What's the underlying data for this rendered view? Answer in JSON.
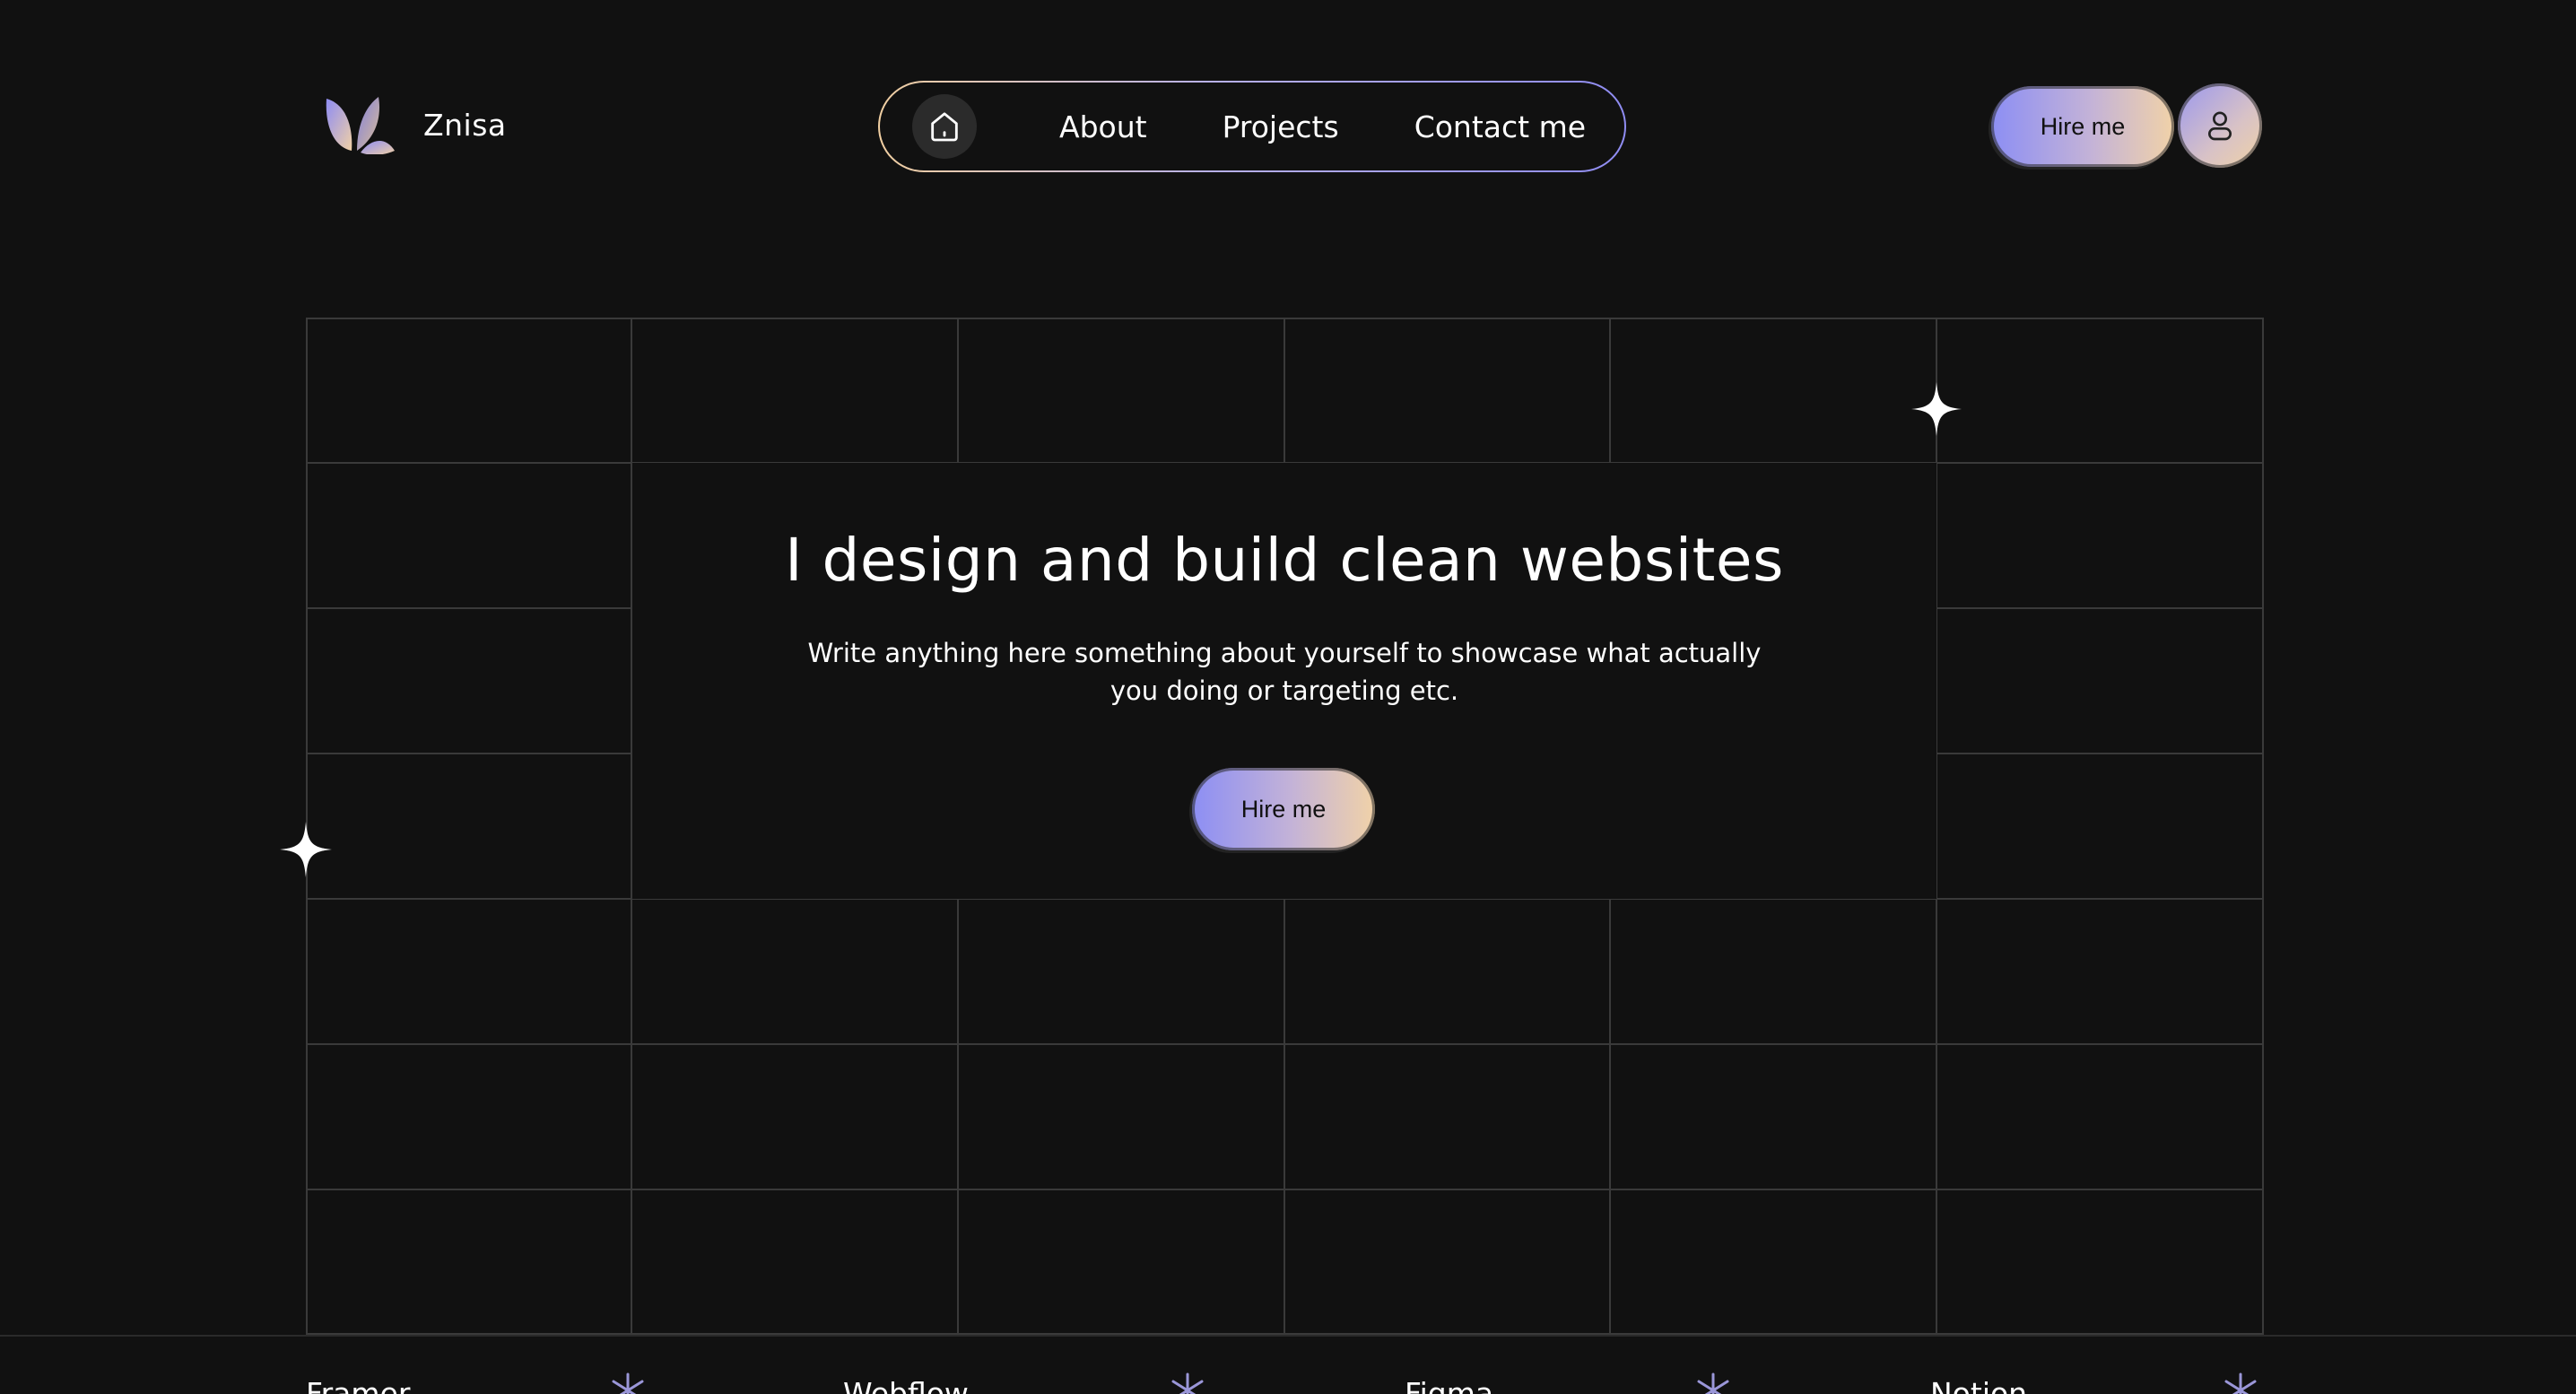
{
  "brand": {
    "name": "Znisa",
    "logo_icon": "leaf-logo-icon"
  },
  "nav": {
    "home_icon": "home-icon",
    "links": [
      {
        "label": "About"
      },
      {
        "label": "Projects"
      },
      {
        "label": "Contact me"
      }
    ],
    "gradient_start": "#f1cfa2",
    "gradient_end": "#8f8cf2"
  },
  "header_actions": {
    "hire_label": "Hire me",
    "profile_icon": "user-icon"
  },
  "hero": {
    "title": "I design and build clean websites",
    "subtitle": "Write anything here something about yourself to showcase what actually you doing or targeting etc.",
    "cta_label": "Hire me"
  },
  "decorations": {
    "sparkle_icon": "sparkle-icon",
    "grid_line_color": "#3a3a3a"
  },
  "marquee": {
    "items": [
      {
        "label": "Framer"
      },
      {
        "label": "Webflow"
      },
      {
        "label": "Figma"
      },
      {
        "label": "Notion"
      }
    ],
    "separator_icon": "asterisk-icon"
  },
  "colors": {
    "background": "#111111",
    "accent_purple": "#8c8ef4",
    "accent_peach": "#f1d2a8"
  }
}
